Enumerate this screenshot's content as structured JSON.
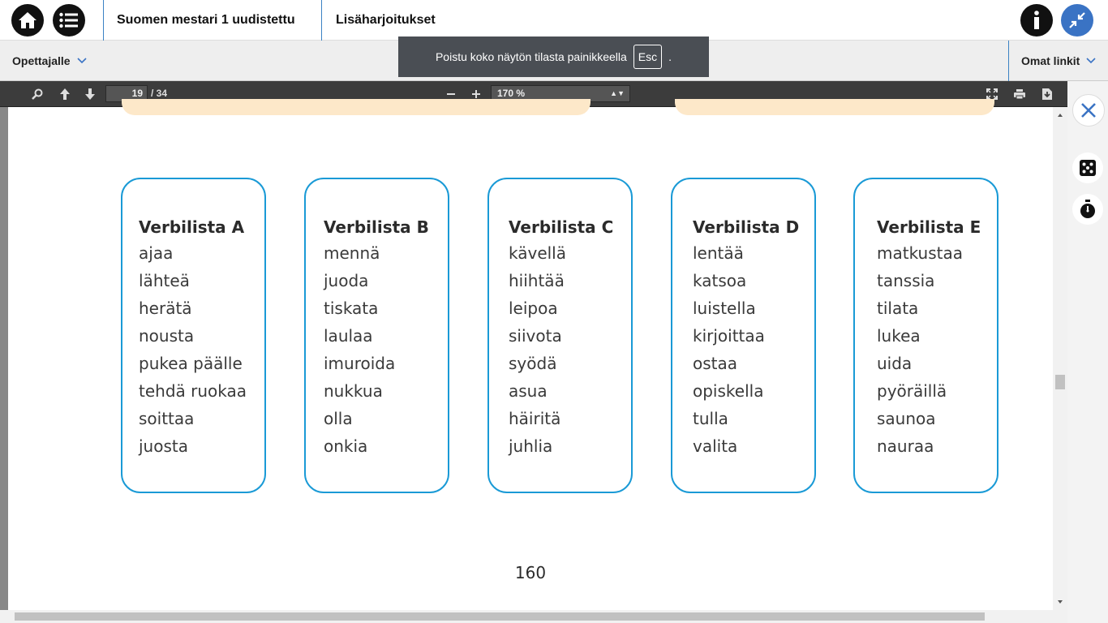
{
  "header": {
    "book_title": "Suomen mestari 1 uudistettu",
    "section_title": "Lisäharjoitukset",
    "icons": [
      "home-icon",
      "menu-icon",
      "info-icon",
      "exit-fullscreen-icon"
    ]
  },
  "subbar": {
    "teacher_link": "Opettajalle",
    "own_links": "Omat linkit"
  },
  "toast": {
    "text": "Poistu koko näytön tilasta painikkeella",
    "key": "Esc",
    "suffix": "."
  },
  "pdf_toolbar": {
    "current_page": "19",
    "page_total": "/ 34",
    "zoom": "170 %"
  },
  "document": {
    "lists": [
      {
        "title": "Verbilista A",
        "words": [
          "ajaa",
          "lähteä",
          "herätä",
          "nousta",
          "pukea päälle",
          "tehdä ruokaa",
          "soittaa",
          "juosta"
        ]
      },
      {
        "title": "Verbilista B",
        "words": [
          "mennä",
          "juoda",
          "tiskata",
          "laulaa",
          "imuroida",
          "nukkua",
          "olla",
          "onkia"
        ]
      },
      {
        "title": "Verbilista C",
        "words": [
          "kävellä",
          "hiihtää",
          "leipoa",
          "siivota",
          "syödä",
          "asua",
          "häiritä",
          "juhlia"
        ]
      },
      {
        "title": "Verbilista D",
        "words": [
          "lentää",
          "katsoa",
          "luistella",
          "kirjoittaa",
          "ostaa",
          "opiskella",
          "tulla",
          "valita"
        ]
      },
      {
        "title": "Verbilista E",
        "words": [
          "matkustaa",
          "tanssia",
          "tilata",
          "lukea",
          "uida",
          "pyöräillä",
          "saunoa",
          "nauraa"
        ]
      }
    ],
    "page_number": "160"
  },
  "colors": {
    "card_border": "#1a9ad6",
    "accent_blue": "#3a73c4",
    "toolbar_bg": "#3c3c3c"
  }
}
